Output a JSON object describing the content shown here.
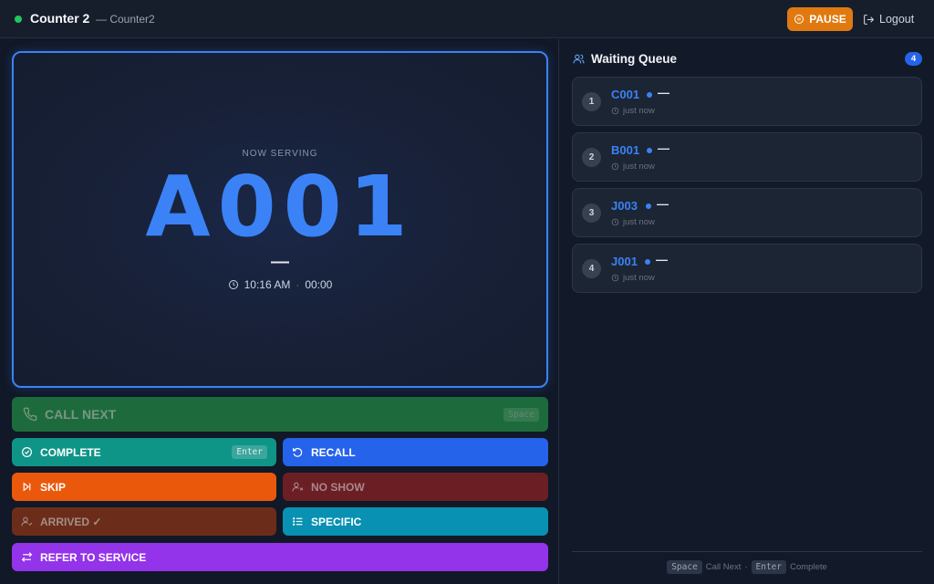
{
  "header": {
    "status_color": "#22c55e",
    "counter_title": "Counter 2",
    "counter_subtitle": "— Counter2",
    "pause_label": "PAUSE",
    "logout_label": "Logout"
  },
  "serving": {
    "label": "NOW SERVING",
    "ticket": "A001",
    "service": "—",
    "time": "10:16 AM",
    "separator": "·",
    "elapsed": "00:00"
  },
  "actions": {
    "call_next": {
      "label": "CALL NEXT",
      "shortcut": "Space"
    },
    "complete": {
      "label": "COMPLETE",
      "shortcut": "Enter"
    },
    "recall": {
      "label": "RECALL"
    },
    "skip": {
      "label": "SKIP"
    },
    "no_show": {
      "label": "NO SHOW"
    },
    "arrived": {
      "label": "ARRIVED ✓"
    },
    "specific": {
      "label": "SPECIFIC"
    },
    "refer": {
      "label": "REFER TO SERVICE"
    }
  },
  "queue": {
    "title": "Waiting Queue",
    "count": "4",
    "items": [
      {
        "position": "1",
        "ticket": "C001",
        "service": "—",
        "time": "just now"
      },
      {
        "position": "2",
        "ticket": "B001",
        "service": "—",
        "time": "just now"
      },
      {
        "position": "3",
        "ticket": "J003",
        "service": "—",
        "time": "just now"
      },
      {
        "position": "4",
        "ticket": "J001",
        "service": "—",
        "time": "just now"
      }
    ]
  },
  "footer": {
    "key1": "Space",
    "action1": "Call Next",
    "separator": "·",
    "key2": "Enter",
    "action2": "Complete"
  },
  "icons": {
    "status": "status-dot",
    "pause": "pause-circle-icon",
    "logout": "logout-icon",
    "clock": "clock-icon",
    "phone": "phone-icon",
    "check": "check-circle-icon",
    "recall": "rotate-ccw-icon",
    "skip": "skip-forward-icon",
    "no_show": "user-x-icon",
    "arrived": "user-check-icon",
    "specific": "list-icon",
    "refer": "arrows-swap-icon",
    "queue": "users-icon"
  }
}
